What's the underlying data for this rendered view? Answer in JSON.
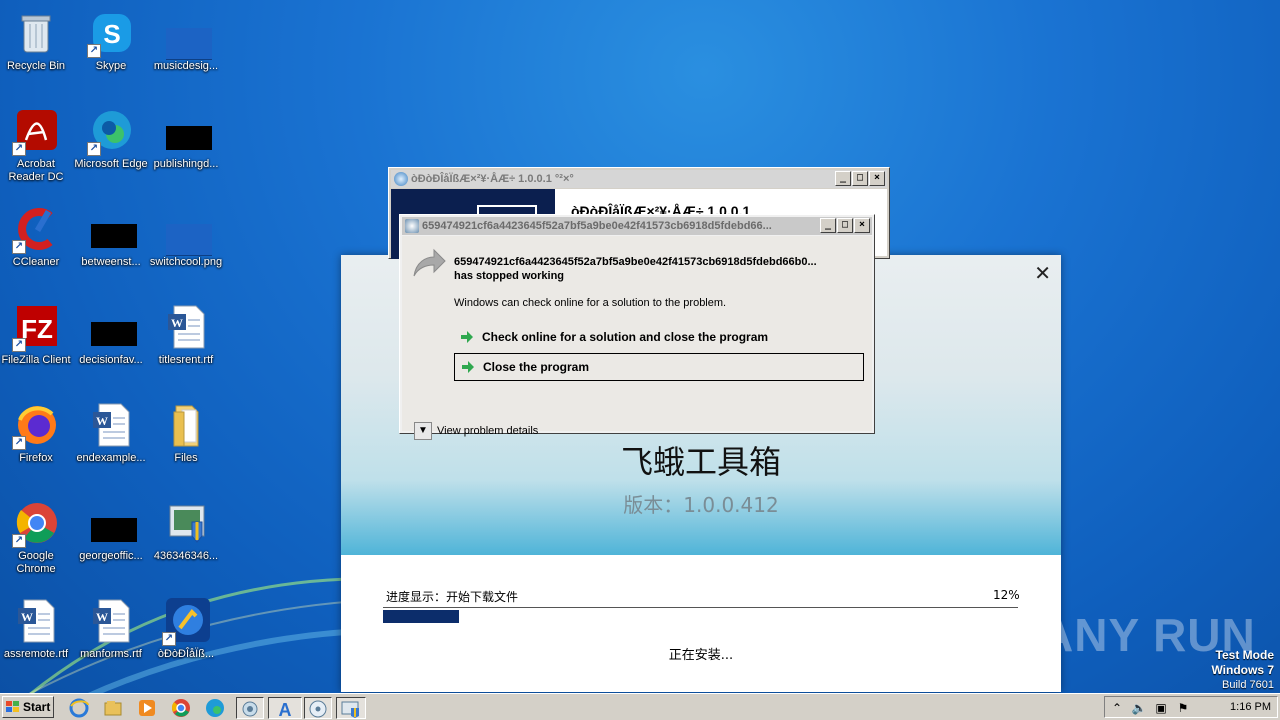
{
  "desktop_icons": [
    {
      "label": "Recycle Bin",
      "icon": "recycle-bin-icon"
    },
    {
      "label": "Skype",
      "icon": "skype-icon"
    },
    {
      "label": "musicdesig...",
      "icon": "image-file-icon"
    },
    {
      "label": "Acrobat Reader DC",
      "icon": "acrobat-icon"
    },
    {
      "label": "Microsoft Edge",
      "icon": "edge-icon"
    },
    {
      "label": "publishingd...",
      "icon": "file-icon"
    },
    {
      "label": "CCleaner",
      "icon": "ccleaner-icon"
    },
    {
      "label": "betweenst...",
      "icon": "file-icon"
    },
    {
      "label": "switchcool.png",
      "icon": "image-file-icon"
    },
    {
      "label": "FileZilla Client",
      "icon": "filezilla-icon"
    },
    {
      "label": "decisionfav...",
      "icon": "file-icon"
    },
    {
      "label": "titlesrent.rtf",
      "icon": "word-doc-icon"
    },
    {
      "label": "Firefox",
      "icon": "firefox-icon"
    },
    {
      "label": "endexample...",
      "icon": "word-doc-icon"
    },
    {
      "label": "Files",
      "icon": "folder-icon"
    },
    {
      "label": "Google Chrome",
      "icon": "chrome-icon"
    },
    {
      "label": "georgeoffic...",
      "icon": "file-icon"
    },
    {
      "label": "436346346...",
      "icon": "installer-icon"
    },
    {
      "label": "assremote.rtf",
      "icon": "word-doc-icon"
    },
    {
      "label": "manforms.rtf",
      "icon": "word-doc-icon"
    },
    {
      "label": "òÐòÐÎåÏß...",
      "icon": "setup-icon"
    }
  ],
  "back_window": {
    "title": "òÐòÐÎåÏßÆ×²¥·ÅÆ÷ 1.0.0.1 °²×°",
    "heading": "òÐòÐÎåÏßÆ×²¥·ÅÆ÷ 1.0.0.1",
    "min": "_",
    "max": "□",
    "close": "×"
  },
  "installer": {
    "close": "✕",
    "app_title": "飞蛾工具箱",
    "version": "版本：1.0.0.412",
    "progress_label": "进度显示：开始下载文件",
    "progress_percent_text": "12%",
    "progress_value": 0.12,
    "status": "正在安装..."
  },
  "error_dialog": {
    "title": "659474921cf6a4423645f52a7bf5a9be0e42f41573cb6918d5fdebd66...",
    "heading_line1": "659474921cf6a4423645f52a7bf5a9be0e42f41573cb6918d5fdebd66b0...",
    "heading_line2": "has stopped working",
    "description": "Windows can check online for a solution to the problem.",
    "option1": "Check online for a solution and close the program",
    "option2": "Close the program",
    "details": "View problem details",
    "min": "_",
    "max": "□",
    "close": "×"
  },
  "watermark": "ANY RUN",
  "test_mode": {
    "line1": "Test Mode",
    "line2": "Windows 7",
    "line3": "Build 7601"
  },
  "taskbar": {
    "start_label": "Start",
    "clock": "1:16 PM",
    "items": [
      "ie-icon",
      "explorer-icon",
      "media-player-icon",
      "chrome-icon",
      "edge-icon",
      "setup-icon",
      "font-app-icon",
      "disc-icon",
      "installer-icon"
    ]
  },
  "colors": {
    "desktop": "#1a73d2",
    "progress_fill": "#0c2d6b",
    "hero_bottom": "#4fb4d8"
  }
}
